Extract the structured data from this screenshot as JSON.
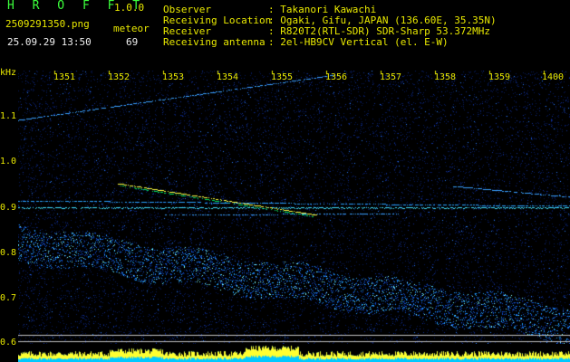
{
  "header": {
    "app_name": "H R O F F T",
    "version": "1.0.0",
    "filename": "2509291350.png",
    "timestamp": "25.09.29 13:50",
    "meteor_label": "meteor",
    "meteor_count": "69"
  },
  "info": {
    "observer_label": "Observer",
    "observer_value": ": Takanori Kawachi",
    "location_label": "Receiving Location",
    "location_value": ": Ogaki, Gifu, JAPAN (136.60E, 35.35N)",
    "receiver_label": "Receiver",
    "receiver_value": ": R820T2(RTL-SDR) SDR-Sharp 53.372MHz",
    "antenna_label": "Receiving antenna",
    "antenna_value": ": 2el-HB9CV Vertical (el. E-W)"
  },
  "axis": {
    "y_unit": "kHz",
    "y_ticks": [
      "1.1",
      "1.0",
      "0.9",
      "0.8",
      "0.7",
      "0.6"
    ],
    "x_ticks": [
      "1351",
      "1352",
      "1353",
      "1354",
      "1355",
      "1356",
      "1357",
      "1358",
      "1359",
      "1400"
    ]
  },
  "colors": {
    "background": "#000000",
    "noise": "#0a2a8a",
    "signal": "#00d0ff",
    "hot": "#ffff40",
    "text_yellow": "#e8e800",
    "text_green": "#3cff3c",
    "text_white": "#f0f0f0"
  }
}
